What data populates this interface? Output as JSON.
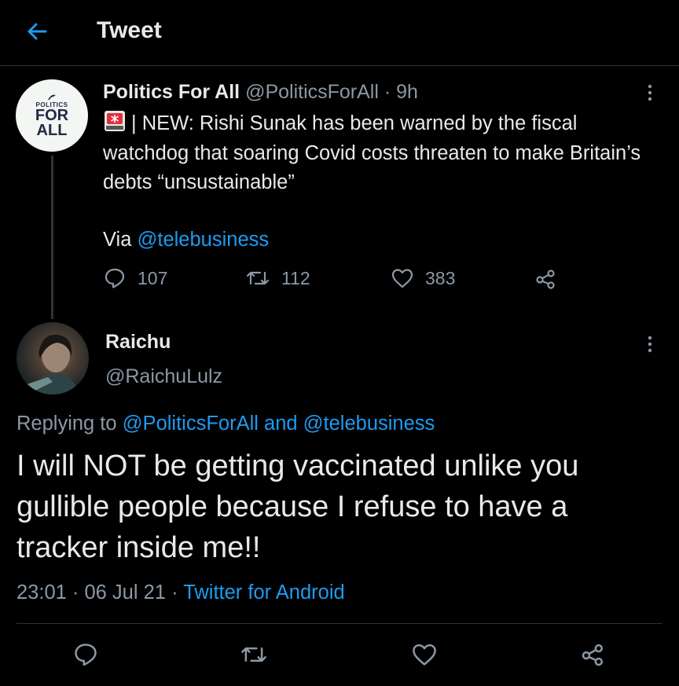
{
  "header": {
    "title": "Tweet",
    "back_icon": "arrow-left-icon",
    "accent": "#1d9bf0"
  },
  "original_tweet": {
    "avatar": {
      "line1": "POLITICS",
      "line2": "FOR",
      "line3": "ALL"
    },
    "display_name": "Politics For All",
    "handle": "@PoliticsForAll",
    "separator": " · ",
    "time_ago": "9h",
    "alert_emoji": "rotating-light-icon",
    "text": "| NEW: Rishi Sunak has been warned by the fiscal watchdog that soaring Covid costs threaten to make Britain’s debts “unsustainable”",
    "via_label": "Via ",
    "via_mention": "@telebusiness",
    "stats": {
      "replies": "107",
      "retweets": "112",
      "likes": "383"
    }
  },
  "reply_tweet": {
    "display_name": "Raichu",
    "handle": "@RaichuLulz",
    "replying_prefix": "Replying to ",
    "replying_mention_1": "@PoliticsForAll",
    "replying_and": " and ",
    "replying_mention_2": "@telebusiness",
    "text": "I will NOT be getting vaccinated unlike you gullible people because I refuse to have a tracker inside me!!",
    "time": "23:01",
    "meta_sep_1": " · ",
    "date": "06 Jul 21",
    "meta_sep_2": " · ",
    "source": "Twitter for Android"
  },
  "colors": {
    "background": "#000000",
    "text": "#e7e9ea",
    "muted": "#8b98a5",
    "link": "#1d9bf0",
    "divider": "#2f3336"
  }
}
